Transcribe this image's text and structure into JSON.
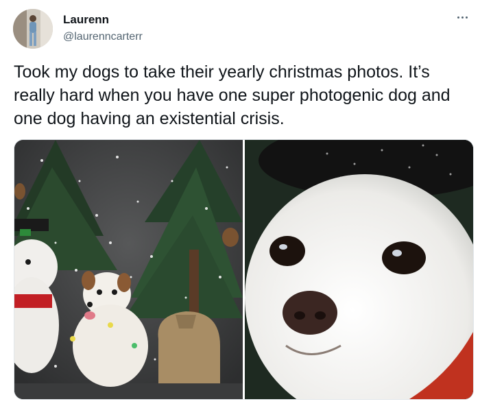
{
  "author": {
    "display_name": "Laurenn",
    "handle": "@laurenncarterr",
    "avatar_icon": "user-avatar-photo"
  },
  "tweet": {
    "text": "Took my dogs to take their yearly christmas photos. It’s really hard when you have one super photogenic dog and one dog having an existential crisis.",
    "more_icon": "more-options-icon"
  },
  "media": {
    "photo_count": 2,
    "photos": [
      {
        "label": "two dogs posing with christmas trees"
      },
      {
        "label": "close-up of white dog wearing a hat"
      }
    ]
  },
  "colors": {
    "text_primary": "#0f1419",
    "text_secondary": "#536471",
    "background": "#ffffff"
  }
}
